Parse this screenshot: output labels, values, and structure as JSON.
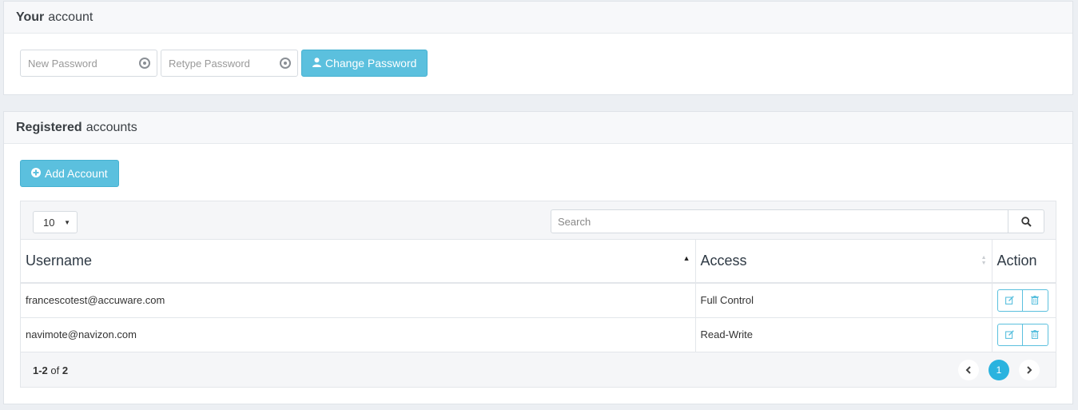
{
  "your_account": {
    "title_bold": "Your",
    "title_rest": "account",
    "new_password_placeholder": "New Password",
    "retype_password_placeholder": "Retype Password",
    "change_password_label": "Change Password"
  },
  "registered": {
    "title_bold": "Registered",
    "title_rest": "accounts",
    "add_account_label": "Add Account",
    "page_size": "10",
    "search_placeholder": "Search",
    "columns": {
      "username": "Username",
      "access": "Access",
      "action": "Action"
    },
    "rows": [
      {
        "username": "francescotest@accuware.com",
        "access": "Full Control"
      },
      {
        "username": "navimote@navizon.com",
        "access": "Read-Write"
      }
    ],
    "count_range": "1-2",
    "count_of": "of",
    "count_total": "2",
    "current_page": "1"
  },
  "colors": {
    "accent": "#5bc0de",
    "page_active": "#2ab3df"
  },
  "icons": [
    "eye-icon",
    "user-icon",
    "plus-circle-icon",
    "search-icon",
    "sort-asc-icon",
    "sort-icon",
    "edit-icon",
    "trash-icon",
    "chevron-left-icon",
    "chevron-right-icon"
  ]
}
